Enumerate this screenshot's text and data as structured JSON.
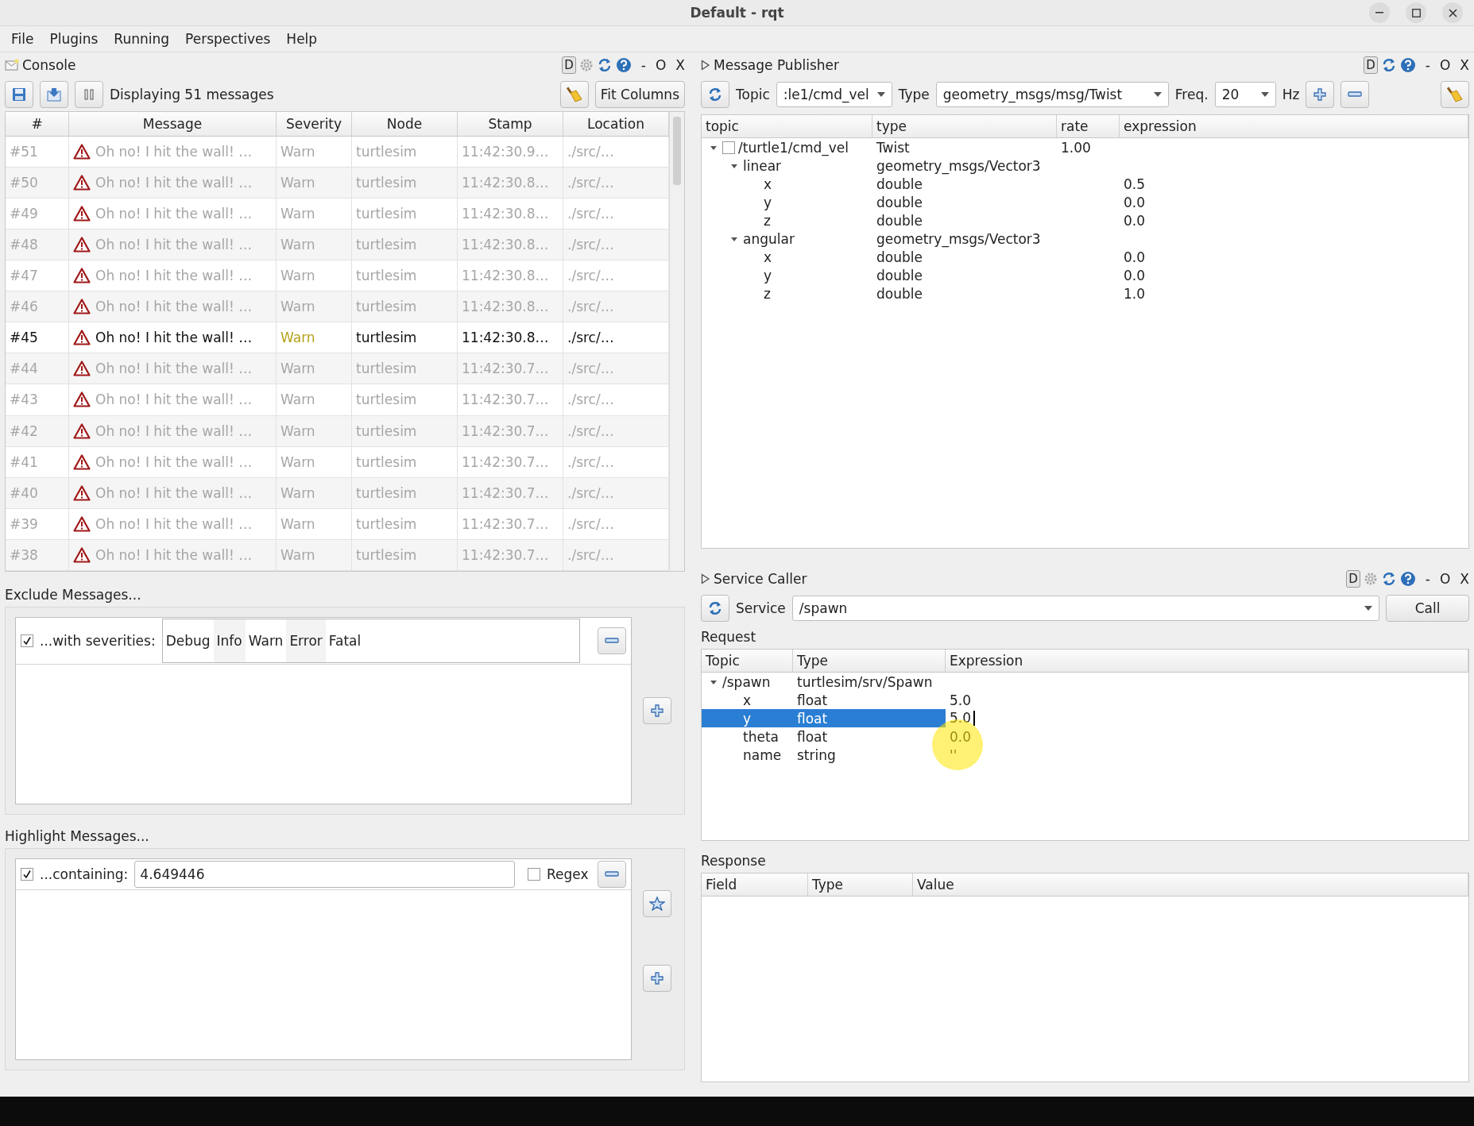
{
  "window": {
    "title": "Default - rqt"
  },
  "menu": [
    {
      "label": "File"
    },
    {
      "label": "Plugins"
    },
    {
      "label": "Running"
    },
    {
      "label": "Perspectives"
    },
    {
      "label": "Help"
    }
  ],
  "console": {
    "title": "Console",
    "dock_badge": "D",
    "dock_controls": [
      "-",
      "O",
      "X"
    ],
    "status": "Displaying 51 messages",
    "fit_button": "Fit Columns",
    "columns": [
      "#",
      "Message",
      "Severity",
      "Node",
      "Stamp",
      "Location"
    ],
    "rows": [
      {
        "number": "#51",
        "message": "Oh no! I hit the wall! …",
        "severity": "Warn",
        "node": "turtlesim",
        "stamp": "11:42:30.9…",
        "location": "./src/…",
        "highlighted": false
      },
      {
        "number": "#50",
        "message": "Oh no! I hit the wall! …",
        "severity": "Warn",
        "node": "turtlesim",
        "stamp": "11:42:30.8…",
        "location": "./src/…",
        "highlighted": false
      },
      {
        "number": "#49",
        "message": "Oh no! I hit the wall! …",
        "severity": "Warn",
        "node": "turtlesim",
        "stamp": "11:42:30.8…",
        "location": "./src/…",
        "highlighted": false
      },
      {
        "number": "#48",
        "message": "Oh no! I hit the wall! …",
        "severity": "Warn",
        "node": "turtlesim",
        "stamp": "11:42:30.8…",
        "location": "./src/…",
        "highlighted": false
      },
      {
        "number": "#47",
        "message": "Oh no! I hit the wall! …",
        "severity": "Warn",
        "node": "turtlesim",
        "stamp": "11:42:30.8…",
        "location": "./src/…",
        "highlighted": false
      },
      {
        "number": "#46",
        "message": "Oh no! I hit the wall! …",
        "severity": "Warn",
        "node": "turtlesim",
        "stamp": "11:42:30.8…",
        "location": "./src/…",
        "highlighted": false
      },
      {
        "number": "#45",
        "message": "Oh no! I hit the wall! …",
        "severity": "Warn",
        "node": "turtlesim",
        "stamp": "11:42:30.8…",
        "location": "./src/…",
        "highlighted": true
      },
      {
        "number": "#44",
        "message": "Oh no! I hit the wall! …",
        "severity": "Warn",
        "node": "turtlesim",
        "stamp": "11:42:30.7…",
        "location": "./src/…",
        "highlighted": false
      },
      {
        "number": "#43",
        "message": "Oh no! I hit the wall! …",
        "severity": "Warn",
        "node": "turtlesim",
        "stamp": "11:42:30.7…",
        "location": "./src/…",
        "highlighted": false
      },
      {
        "number": "#42",
        "message": "Oh no! I hit the wall! …",
        "severity": "Warn",
        "node": "turtlesim",
        "stamp": "11:42:30.7…",
        "location": "./src/…",
        "highlighted": false
      },
      {
        "number": "#41",
        "message": "Oh no! I hit the wall! …",
        "severity": "Warn",
        "node": "turtlesim",
        "stamp": "11:42:30.7…",
        "location": "./src/…",
        "highlighted": false
      },
      {
        "number": "#40",
        "message": "Oh no! I hit the wall! …",
        "severity": "Warn",
        "node": "turtlesim",
        "stamp": "11:42:30.7…",
        "location": "./src/…",
        "highlighted": false
      },
      {
        "number": "#39",
        "message": "Oh no! I hit the wall! …",
        "severity": "Warn",
        "node": "turtlesim",
        "stamp": "11:42:30.7…",
        "location": "./src/…",
        "highlighted": false
      },
      {
        "number": "#38",
        "message": "Oh no! I hit the wall! …",
        "severity": "Warn",
        "node": "turtlesim",
        "stamp": "11:42:30.7…",
        "location": "./src/…",
        "highlighted": false
      }
    ]
  },
  "exclude": {
    "title": "Exclude Messages...",
    "filters": [
      {
        "checked": true,
        "label": "...with severities:",
        "severities": [
          "Debug",
          "Info",
          "Warn",
          "Error",
          "Fatal"
        ]
      }
    ]
  },
  "highlight": {
    "title": "Highlight Messages...",
    "filters": [
      {
        "checked": true,
        "label": "...containing:",
        "value": "4.649446",
        "regex": {
          "label": "Regex",
          "checked": false
        }
      }
    ]
  },
  "publisher": {
    "title": "Message Publisher",
    "dock_badge": "D",
    "dock_controls": [
      "-",
      "O",
      "X"
    ],
    "topic_label": "Topic",
    "topic_value": ":le1/cmd_vel",
    "type_label": "Type",
    "type_value": "geometry_msgs/msg/Twist",
    "freq_label": "Freq.",
    "freq_value": "20",
    "hz_label": "Hz",
    "columns": [
      "topic",
      "type",
      "rate",
      "expression"
    ],
    "tree": [
      {
        "topic": "/turtle1/cmd_vel",
        "type": "Twist",
        "rate": "1.00",
        "checked": false,
        "expanded": true,
        "children": [
          {
            "topic": "linear",
            "type": "geometry_msgs/Vector3",
            "expanded": true,
            "children": [
              {
                "topic": "x",
                "type": "double",
                "expression": "0.5"
              },
              {
                "topic": "y",
                "type": "double",
                "expression": "0.0"
              },
              {
                "topic": "z",
                "type": "double",
                "expression": "0.0"
              }
            ]
          },
          {
            "topic": "angular",
            "type": "geometry_msgs/Vector3",
            "expanded": true,
            "children": [
              {
                "topic": "x",
                "type": "double",
                "expression": "0.0"
              },
              {
                "topic": "y",
                "type": "double",
                "expression": "0.0"
              },
              {
                "topic": "z",
                "type": "double",
                "expression": "1.0"
              }
            ]
          }
        ]
      }
    ]
  },
  "service_caller": {
    "title": "Service Caller",
    "dock_badge": "D",
    "dock_controls": [
      "-",
      "O",
      "X"
    ],
    "service_label": "Service",
    "service_value": "/spawn",
    "call_button": "Call",
    "request_label": "Request",
    "request_columns": [
      "Topic",
      "Type",
      "Expression"
    ],
    "request_tree": [
      {
        "topic": "/spawn",
        "type": "turtlesim/srv/Spawn",
        "expanded": true,
        "selected": false,
        "children": [
          {
            "topic": "x",
            "type": "float",
            "expression": "5.0",
            "selected": false,
            "editing": false
          },
          {
            "topic": "y",
            "type": "float",
            "expression": "5.0",
            "selected": true,
            "editing": true
          },
          {
            "topic": "theta",
            "type": "float",
            "expression": "0.0",
            "selected": false,
            "editing": false
          },
          {
            "topic": "name",
            "type": "string",
            "expression": "''",
            "selected": false,
            "editing": false
          }
        ]
      }
    ],
    "response_label": "Response",
    "response_columns": [
      "Field",
      "Type",
      "Value"
    ]
  }
}
